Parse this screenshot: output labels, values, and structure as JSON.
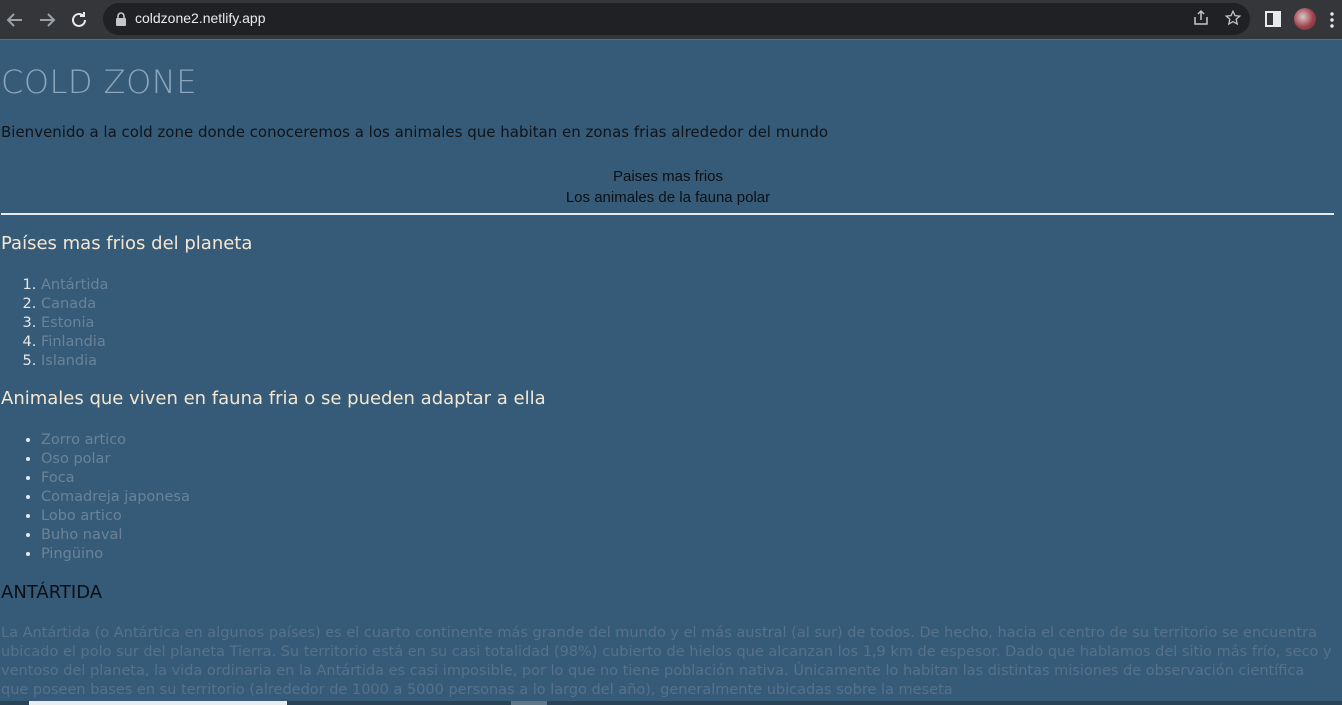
{
  "browser": {
    "url": "coldzone2.netlify.app"
  },
  "page": {
    "title": "COLD ZONE",
    "intro": "Bienvenido a la cold zone donde conoceremos a los animales que habitan en zonas frias alrededor del mundo",
    "nav_links": [
      "Paises mas frios",
      "Los animales de la fauna polar"
    ],
    "countries_heading": "Países mas frios del planeta",
    "countries": [
      "Antártida",
      "Canada",
      "Estonia",
      "Finlandia",
      "Islandia"
    ],
    "animals_heading": "Animales que viven en fauna fria o se pueden adaptar a ella",
    "animals": [
      "Zorro artico",
      "Oso polar",
      "Foca",
      "Comadreja japonesa",
      "Lobo artico",
      "Buho naval",
      "Pingüino"
    ],
    "antartida_heading": "ANTÁRTIDA",
    "antartida_text": "La Antártida (o Antártica en algunos países) es el cuarto continente más grande del mundo y el más austral (al sur) de todos. De hecho, hacia el centro de su territorio se encuentra ubicado el polo sur del planeta Tierra. Su territorio está en su casi totalidad (98%) cubierto de hielos que alcanzan los 1,9 km de espesor. Dado que hablamos del sitio más frío, seco y ventoso del planeta, la vida ordinaria en la Antártida es casi imposible, por lo que no tiene población nativa. Únicamente lo habitan las distintas misiones de observación científica que poseen bases en su territorio (alrededor de 1000 a 5000 personas a lo largo del año), generalmente ubicadas sobre la meseta"
  },
  "colors": {
    "page_background": "#365b78",
    "title": "#8ba6bd",
    "headings": "#f3e7d3",
    "list_text": "#6a8399",
    "browser_chrome": "#35363a"
  },
  "icons": {
    "back": "back-arrow-icon",
    "forward": "forward-arrow-icon",
    "reload": "reload-icon",
    "lock": "lock-icon",
    "share": "share-icon",
    "bookmark": "star-icon",
    "side_panel": "side-panel-icon",
    "profile": "avatar",
    "menu": "kebab-menu-icon"
  }
}
